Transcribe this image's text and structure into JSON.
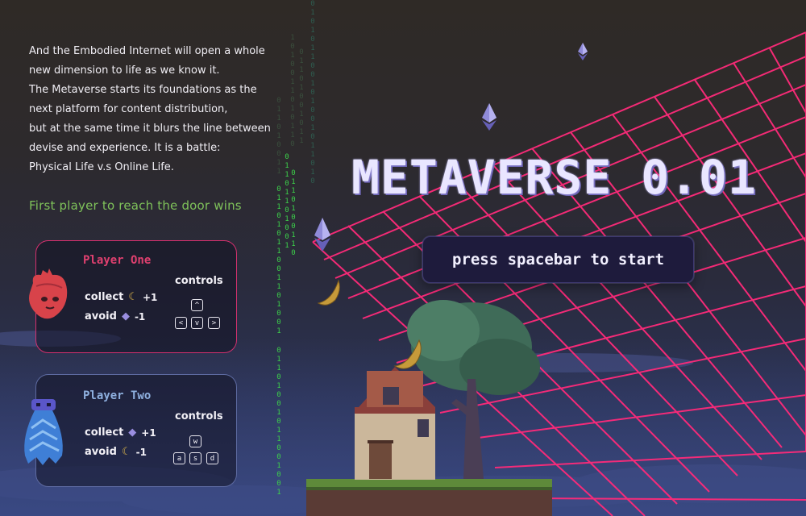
{
  "intro": {
    "lines": [
      "And the Embodied Internet will open a whole",
      "new dimension to life as we know it.",
      "The Metaverse starts its foundations as the",
      "next platform for content distribution,",
      "but at the same time it blurs the line between",
      "devise and experience. It is a battle:",
      "Physical Life v.s Online Life."
    ]
  },
  "win_rule": "First player to reach the door wins",
  "player_one": {
    "name": "Player One",
    "collect_label": "collect",
    "collect_amount": "+1",
    "collect_icon": "banana-icon",
    "avoid_label": "avoid",
    "avoid_amount": "-1",
    "avoid_icon": "ethereum-gem-icon",
    "controls_label": "controls",
    "keys": [
      "^",
      "<",
      "v",
      ">"
    ],
    "avatar": "heart-avatar"
  },
  "player_two": {
    "name": "Player Two",
    "collect_label": "collect",
    "collect_amount": "+1",
    "collect_icon": "ethereum-gem-icon",
    "avoid_label": "avoid",
    "avoid_amount": "-1",
    "avoid_icon": "banana-icon",
    "controls_label": "controls",
    "keys": [
      "w",
      "a",
      "s",
      "d"
    ],
    "avatar": "ghost-avatar"
  },
  "title": "METAVERSE 0.01",
  "start_button": "press spacebar to start",
  "colors": {
    "grid": "#ff2a7a",
    "player_one_accent": "#d4306e",
    "player_two_accent": "#5d6aa0",
    "win_text": "#7fc25a",
    "binary_green": "#3cd14a"
  }
}
